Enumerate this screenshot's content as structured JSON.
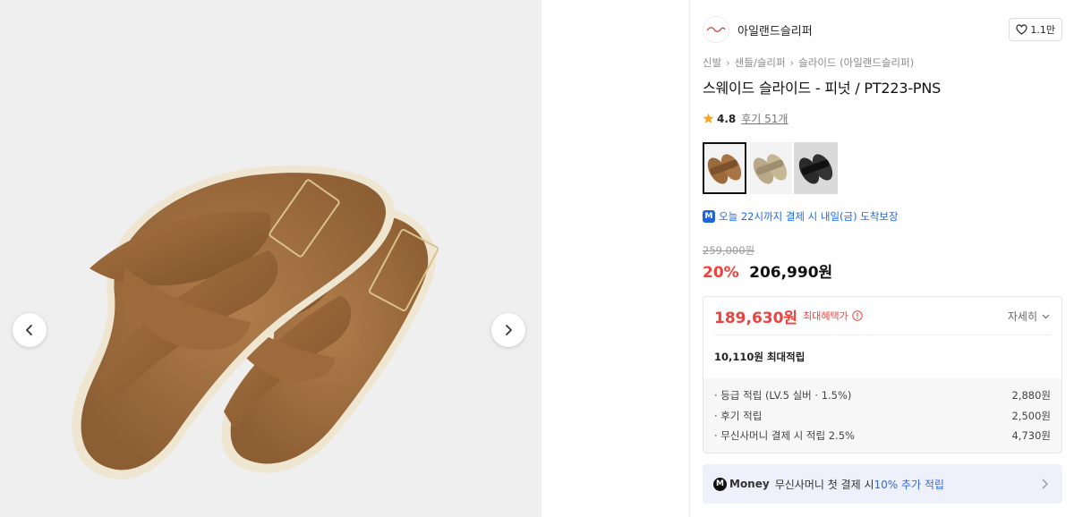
{
  "gallery": {
    "prev_icon": "chevron-left-icon",
    "next_icon": "chevron-right-icon",
    "image_alt": "suede slide sandals"
  },
  "brand": {
    "name": "아일랜드슬리퍼",
    "logo_icon": "brand-logo-icon",
    "like_count": "1.1만",
    "like_icon": "heart-icon"
  },
  "breadcrumb": [
    "신발",
    "샌들/슬리퍼",
    "슬라이드 (아일랜드슬리퍼)"
  ],
  "product": {
    "title": "스웨이드 슬라이드 - 피넛 / PT223-PNS",
    "rating": "4.8",
    "reviews": "후기 51개",
    "colors": [
      {
        "name": "brown",
        "swatch": "#9a6a3c",
        "active": true
      },
      {
        "name": "beige",
        "swatch": "#b8a98a",
        "active": false
      },
      {
        "name": "black",
        "swatch": "#222222",
        "active": false
      }
    ]
  },
  "delivery": {
    "badge": "M",
    "text": "오늘 22시까지 결제 시 내일(금) 도착보장"
  },
  "price": {
    "original": "259,000원",
    "discount": "20%",
    "sale": "206,990원"
  },
  "benefits": {
    "max_price": "189,630원",
    "max_label": "최대혜택가",
    "detail_label": "자세히",
    "points_total": "10,110원 최대적립",
    "items": [
      {
        "label": "· 등급 적립 (LV.5 실버 · 1.5%)",
        "value": "2,880원"
      },
      {
        "label": "· 후기 적립",
        "value": "2,500원"
      },
      {
        "label": "· 무신사머니 결제 시 적립 2.5%",
        "value": "4,730원"
      }
    ]
  },
  "money_banner": {
    "badge": "M",
    "brand": "Money",
    "text_prefix": "무신사머니 첫 결제 시 ",
    "highlight": "10% 추가 적립"
  },
  "colors": {
    "accent_red": "#f0413c",
    "accent_blue": "#1c6be6",
    "banner_bg": "#eef1fb"
  }
}
